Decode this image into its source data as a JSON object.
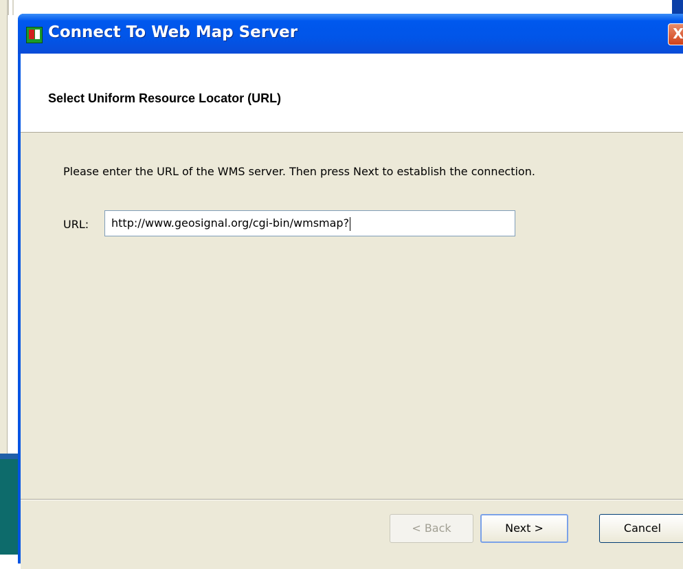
{
  "dialog": {
    "title": "Connect To Web Map Server",
    "close_label": "X",
    "header_title": "Select Uniform Resource Locator (URL)",
    "instruction": "Please enter the URL of the WMS server. Then press Next to establish the connection.",
    "url_label": "URL:",
    "url_value": "http://www.geosignal.org/cgi-bin/wmsmap?",
    "buttons": {
      "back": "< Back",
      "next": "Next >",
      "cancel": "Cancel"
    }
  },
  "colors": {
    "titlebar": "#0058ee",
    "dialog_bg": "#ece9d8",
    "header_bg": "#ffffff",
    "close_button": "#d2421a"
  }
}
